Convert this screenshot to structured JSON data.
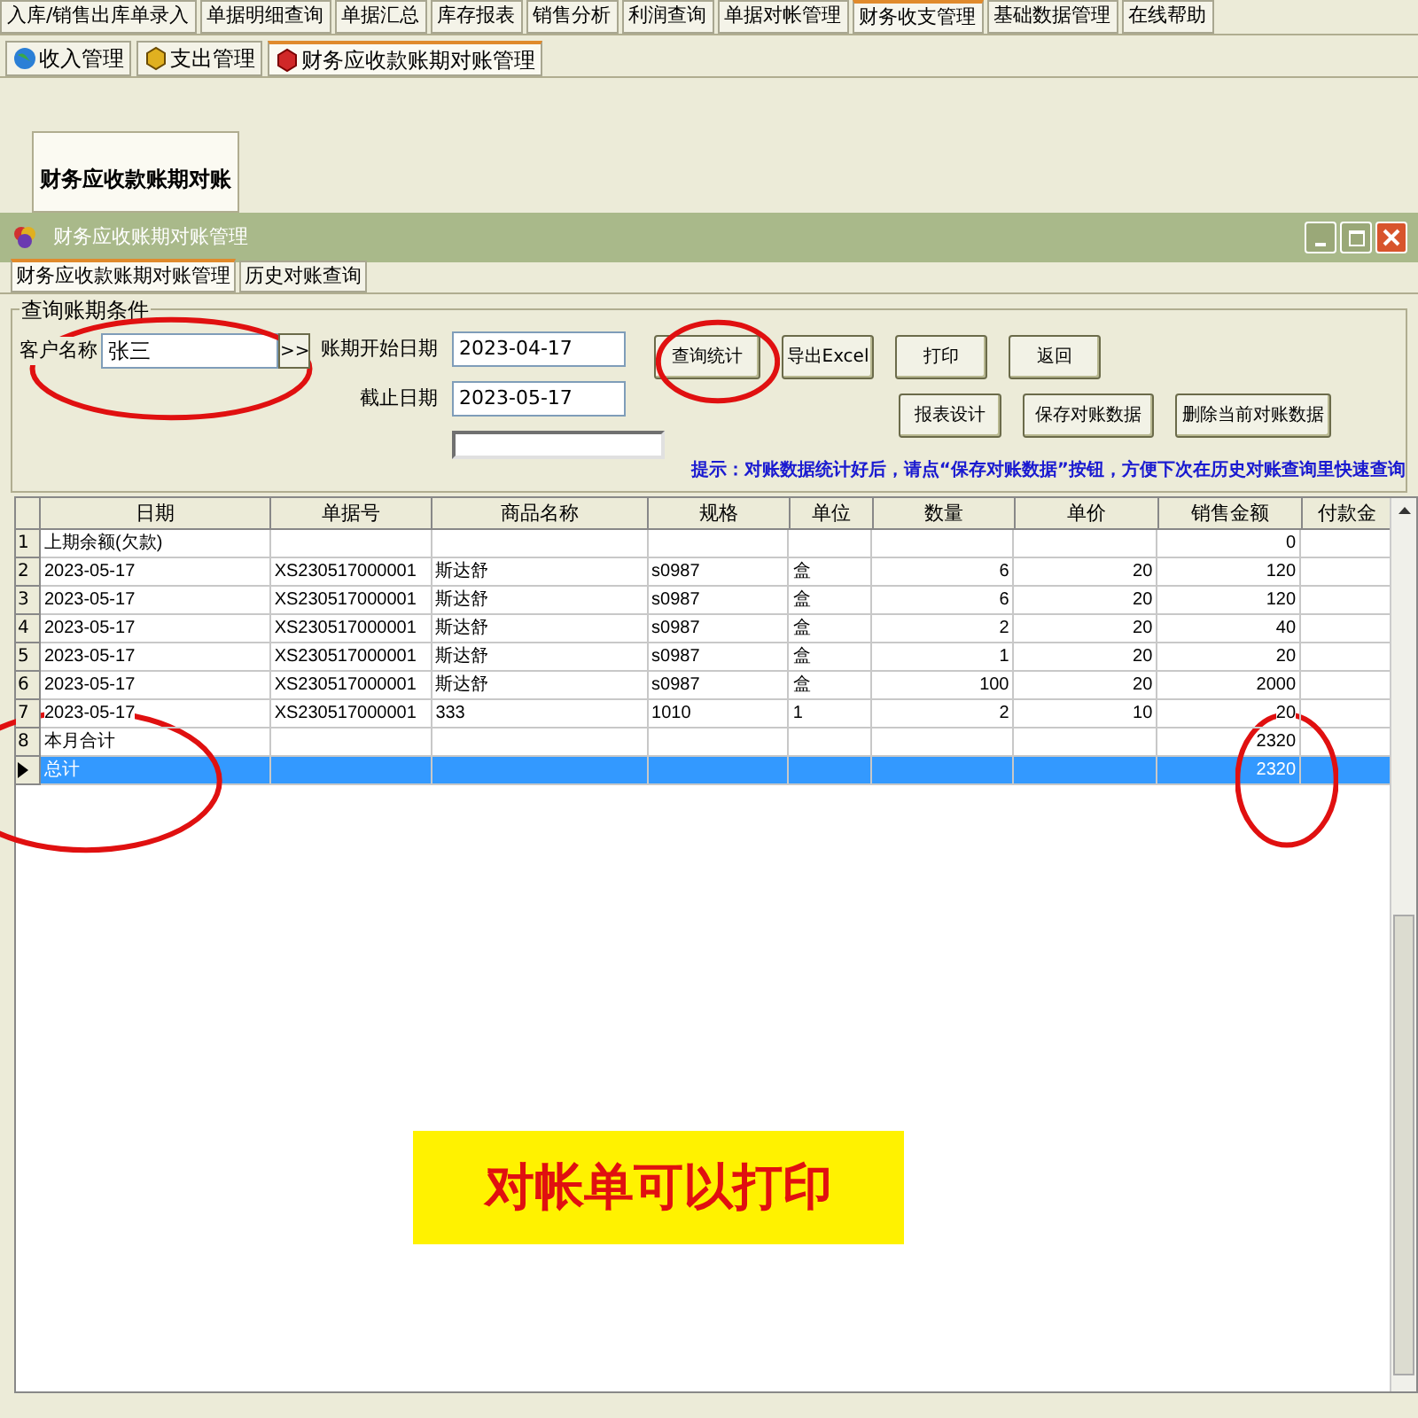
{
  "main_tabs": [
    {
      "label": "入库/销售出库单录入",
      "selected": false
    },
    {
      "label": "单据明细查询",
      "selected": false
    },
    {
      "label": "单据汇总",
      "selected": false
    },
    {
      "label": "库存报表",
      "selected": false
    },
    {
      "label": "销售分析",
      "selected": false
    },
    {
      "label": "利润查询",
      "selected": false
    },
    {
      "label": "单据对帐管理",
      "selected": false
    },
    {
      "label": "财务收支管理",
      "selected": true
    },
    {
      "label": "基础数据管理",
      "selected": false
    },
    {
      "label": "在线帮助",
      "selected": false
    }
  ],
  "sub_tabs": [
    {
      "label": "收入管理",
      "kind": "income",
      "selected": false
    },
    {
      "label": "支出管理",
      "kind": "expense",
      "selected": false
    },
    {
      "label": "财务应收款账期对账管理",
      "kind": "receivable",
      "selected": true
    }
  ],
  "module_button": "财务应收款账期对账",
  "window": {
    "title": "财务应收账期对账管理"
  },
  "window_tabs": [
    {
      "label": "财务应收款账期对账管理",
      "selected": true
    },
    {
      "label": "历史对账查询",
      "selected": false
    }
  ],
  "query_group": {
    "title": "查询账期条件",
    "customer_label": "客户名称",
    "customer_value": "张三",
    "picker_button": ">>",
    "start_label": "账期开始日期",
    "start_value": "2023-04-17",
    "end_label": "截止日期",
    "end_value": "2023-05-17",
    "buttons_row1": [
      "查询统计",
      "导出Excel",
      "打印",
      "返回"
    ],
    "buttons_row2": [
      "报表设计",
      "保存对账数据",
      "删除当前对账数据"
    ],
    "hint": "提示：对账数据统计好后，请点“保存对账数据”按钮，方便下次在历史对账查询里快速查询"
  },
  "table": {
    "columns": [
      "日期",
      "单据号",
      "商品名称",
      "规格",
      "单位",
      "数量",
      "单价",
      "销售金额",
      "付款金"
    ],
    "rows": [
      {
        "num": "1",
        "cells": [
          "上期余额(欠款)",
          "",
          "",
          "",
          "",
          "",
          "",
          "0",
          ""
        ],
        "selected": false
      },
      {
        "num": "2",
        "cells": [
          "2023-05-17",
          "XS230517000001",
          "斯达舒",
          "s0987",
          "盒",
          "6",
          "20",
          "120",
          ""
        ],
        "selected": false
      },
      {
        "num": "3",
        "cells": [
          "2023-05-17",
          "XS230517000001",
          "斯达舒",
          "s0987",
          "盒",
          "6",
          "20",
          "120",
          ""
        ],
        "selected": false
      },
      {
        "num": "4",
        "cells": [
          "2023-05-17",
          "XS230517000001",
          "斯达舒",
          "s0987",
          "盒",
          "2",
          "20",
          "40",
          ""
        ],
        "selected": false
      },
      {
        "num": "5",
        "cells": [
          "2023-05-17",
          "XS230517000001",
          "斯达舒",
          "s0987",
          "盒",
          "1",
          "20",
          "20",
          ""
        ],
        "selected": false
      },
      {
        "num": "6",
        "cells": [
          "2023-05-17",
          "XS230517000001",
          "斯达舒",
          "s0987",
          "盒",
          "100",
          "20",
          "2000",
          ""
        ],
        "selected": false
      },
      {
        "num": "7",
        "cells": [
          "2023-05-17",
          "XS230517000001",
          "333",
          "1010",
          "1",
          "2",
          "10",
          "20",
          ""
        ],
        "selected": false
      },
      {
        "num": "8",
        "cells": [
          "本月合计",
          "",
          "",
          "",
          "",
          "",
          "",
          "2320",
          ""
        ],
        "selected": false
      },
      {
        "num": "",
        "cells": [
          "总计",
          "",
          "",
          "",
          "",
          "",
          "",
          "2320",
          ""
        ],
        "selected": true
      }
    ]
  },
  "banner": "对帐单可以打印"
}
